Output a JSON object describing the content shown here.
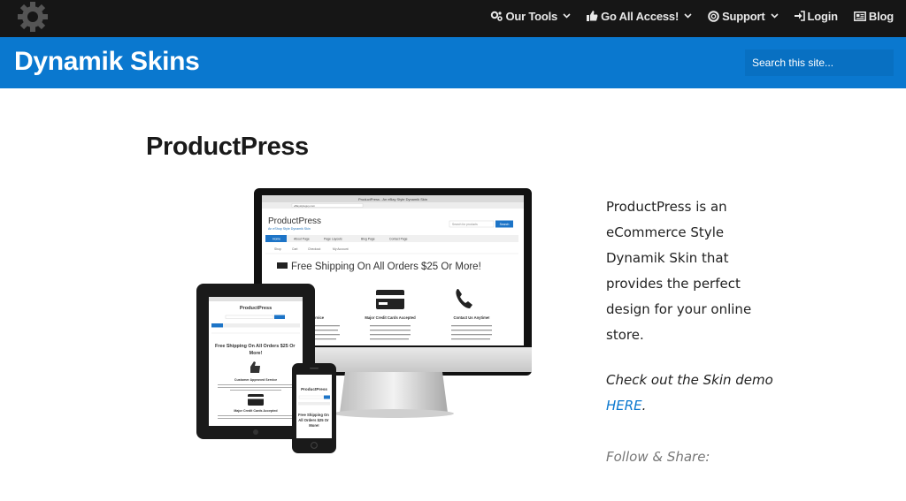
{
  "topbar": {
    "nav": [
      {
        "label": "Our Tools",
        "icon": "gears-icon",
        "dropdown": true
      },
      {
        "label": "Go All Access!",
        "icon": "thumbs-up-icon",
        "dropdown": true
      },
      {
        "label": "Support",
        "icon": "lifebuoy-icon",
        "dropdown": true
      },
      {
        "label": "Login",
        "icon": "sign-in-icon",
        "dropdown": false
      },
      {
        "label": "Blog",
        "icon": "newspaper-icon",
        "dropdown": false
      }
    ]
  },
  "header": {
    "site_title": "Dynamik Skins",
    "search_placeholder": "Search this site..."
  },
  "main": {
    "page_title": "ProductPress",
    "description": "ProductPress is an eCommerce Style Dynamik Skin that provides the perfect design for your online store.",
    "demo_prefix": "Check out the Skin demo",
    "demo_link": "HERE",
    "demo_suffix": ".",
    "follow": "Follow & Share:"
  },
  "mockup": {
    "browser_title": "ProductPress - An eBay Style Dynamik Skin",
    "url": "eBaystyleguy.com",
    "site_name": "ProductPress",
    "tagline": "An eShop Style Dynamik Skin",
    "search_placeholder": "Search for products",
    "search_button": "Search",
    "menu": [
      "Home",
      "About Page",
      "Page Layouts",
      "Blog Page",
      "Contact Page"
    ],
    "submenu": [
      "Shop",
      "Cart",
      "Checkout",
      "My Account"
    ],
    "banner": "Free Shipping On All Orders $25 Or More!",
    "features": [
      "Customer Approved Service",
      "Major Credit Cards Accepted",
      "Contact Us Anytime!"
    ],
    "lorem": "Lorem ipsum dolor sit amet, consectetur adipiscing elit, sed do eiusmod tempor incididunt ut labore et dolore magna aliqua.",
    "tablet_banner": "Free Shipping On All Orders $25 Or More!",
    "phone_banner": "Free Shipping On All Orders $25 Or More!"
  },
  "colors": {
    "topbar": "#161616",
    "brand_blue": "#0a78cf",
    "link": "#0a78cf"
  }
}
